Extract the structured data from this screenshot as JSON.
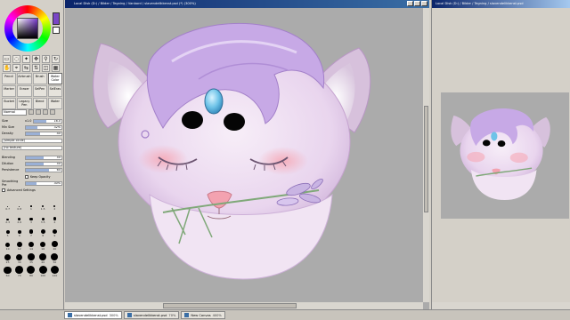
{
  "window": {
    "title": "Local Disk (D:) / Bilder / Tegning / Vanbord / slavendelikkenst.psd (*) (300%)",
    "navigator_title": "Local Disk (D:) / Bilder / Tegning / slavendelikkenst.psd"
  },
  "colors": {
    "main_color": "#7a46c6",
    "sub_color": "#ffffff",
    "canvas_bg": "#ababab",
    "fur": "#f2e6f4",
    "hair": "#c7a9e6",
    "gem": "#6ec3e8"
  },
  "tools": [
    {
      "label": "Pencil",
      "selected": false
    },
    {
      "label": "Airbrush",
      "selected": false
    },
    {
      "label": "Brush",
      "selected": false
    },
    {
      "label": "Water Color",
      "selected": true
    },
    {
      "label": "Marker",
      "selected": false
    },
    {
      "label": "Eraser",
      "selected": false
    },
    {
      "label": "SelPen",
      "selected": false
    },
    {
      "label": "SelEras",
      "selected": false
    },
    {
      "label": "Bucket",
      "selected": false
    },
    {
      "label": "Legacy Pen",
      "selected": false
    },
    {
      "label": "Blend",
      "selected": false
    },
    {
      "label": "Water",
      "selected": false
    }
  ],
  "brush": {
    "blend_mode": "Normal",
    "size_label": "Size",
    "size_mult": "x1.0",
    "size_value": "16.0",
    "min_size_label": "Min Size",
    "min_size_value": "32%",
    "min_size_level": 0.32,
    "density_label": "Density",
    "density_value": "40",
    "density_level": 0.4,
    "shape": "(simple circle)",
    "texture": "(no texture)",
    "blending_label": "Blending",
    "blending_value": "50",
    "blending_level": 0.5,
    "dilution_label": "Dilution",
    "dilution_value": "50",
    "dilution_level": 0.5,
    "persistence_label": "Persistence",
    "persistence_value": "64",
    "persistence_level": 0.64,
    "keep_opacity_label": "Keep Opacity",
    "smoothing_label": "Smoothing Pre",
    "smoothing_value": "30%",
    "smoothing_level": 0.3,
    "advanced_label": "Advanced Settings"
  },
  "brush_sizes": [
    "0.7",
    "0.8",
    "1",
    "1.5",
    "2",
    "2.3",
    "2.6",
    "3",
    "3.5",
    "4",
    "5",
    "6",
    "7",
    "8",
    "9",
    "10",
    "12",
    "14",
    "16",
    "20",
    "25",
    "30",
    "35",
    "40",
    "50",
    "60",
    "70",
    "80",
    "100",
    "120"
  ],
  "tabs": [
    {
      "label": "slavendelikkenst.psd",
      "zoom": "300%",
      "active": true
    },
    {
      "label": "slavendelikkenst.psd",
      "zoom": "70%",
      "active": false
    },
    {
      "label": "New Canvas",
      "zoom": "400%",
      "active": false
    }
  ]
}
